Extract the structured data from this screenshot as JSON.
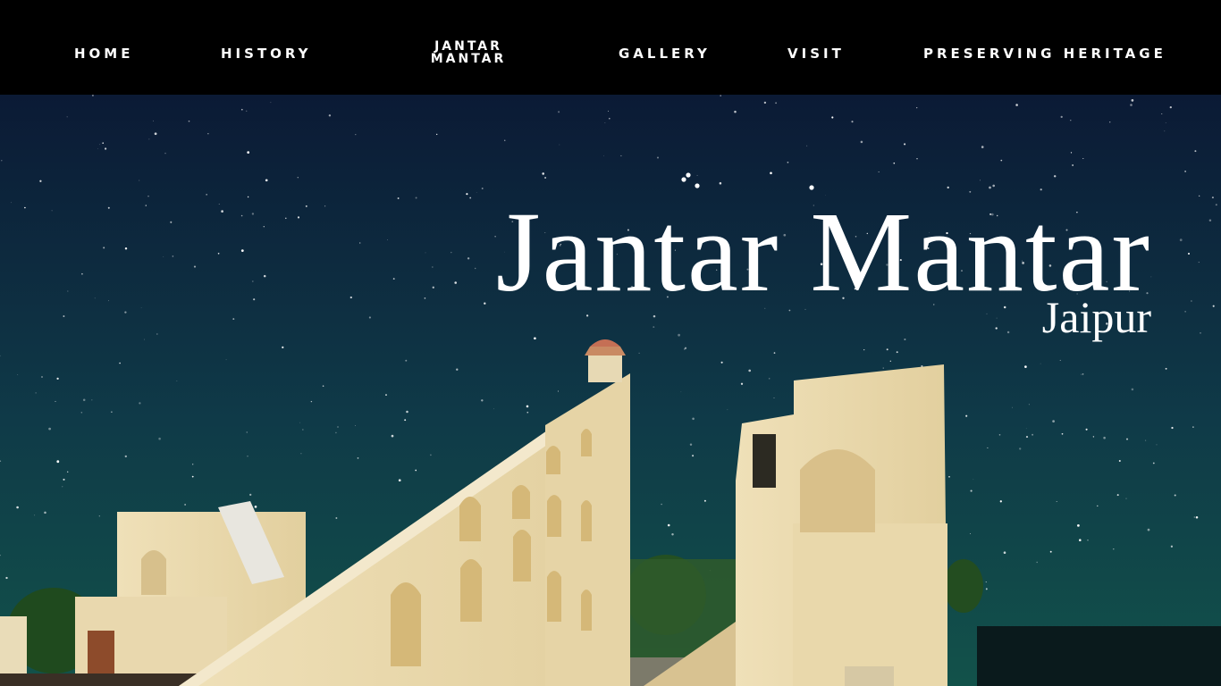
{
  "nav": {
    "items": [
      {
        "label": "HOME"
      },
      {
        "label": "HISTORY"
      },
      {
        "label": "JANTAR MANTAR"
      },
      {
        "label": "GALLERY"
      },
      {
        "label": "VISIT"
      },
      {
        "label": "PRESERVING HERITAGE"
      }
    ]
  },
  "hero": {
    "title": "Jantar Mantar",
    "subtitle": "Jaipur",
    "image_subject": "Jantar Mantar observatory instruments under a starry night sky"
  },
  "colors": {
    "nav_background": "#000000",
    "nav_text": "#ffffff",
    "sky_top": "#0b1a35",
    "sky_bottom": "#12524a",
    "stone": "#ecdcb3"
  }
}
